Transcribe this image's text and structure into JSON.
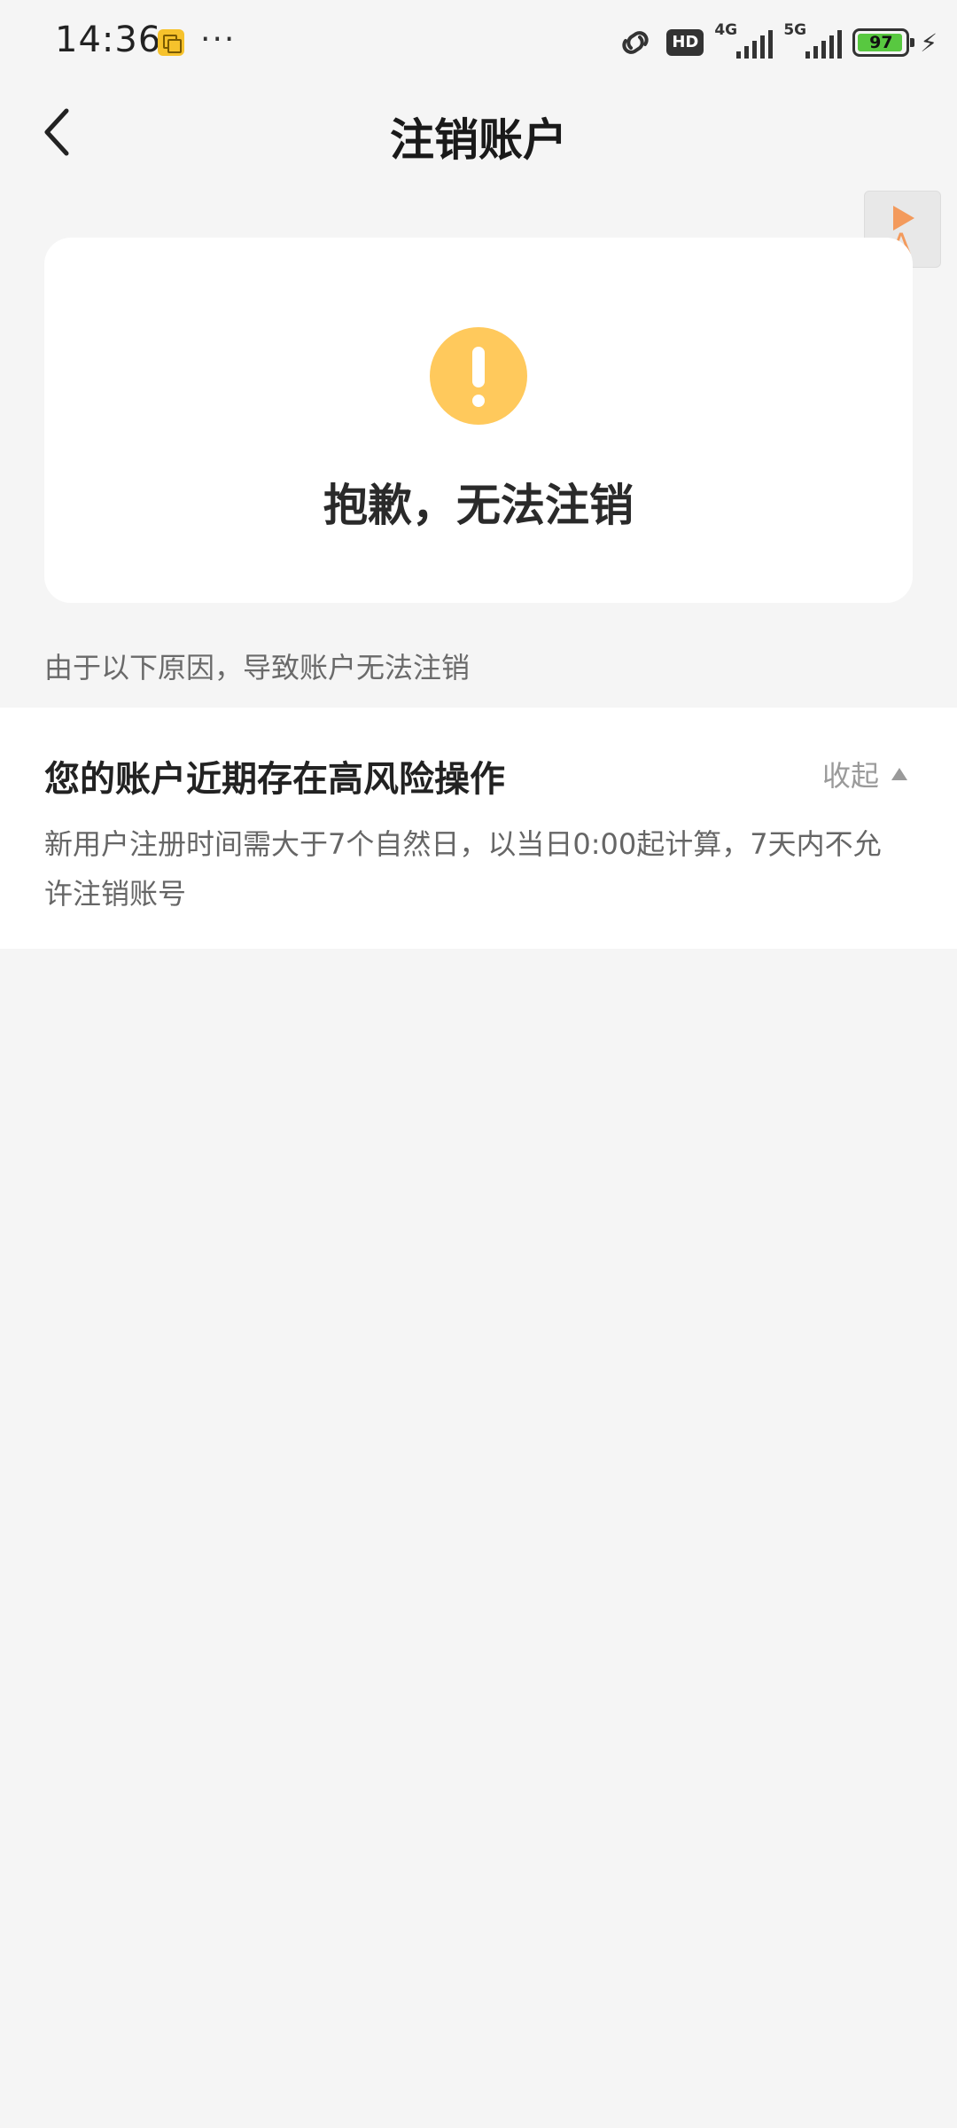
{
  "status_bar": {
    "time": "14:36",
    "more": "···",
    "hd": "HD",
    "net1": "4G",
    "net2": "5G",
    "battery": "97",
    "icons": [
      "notification-icon",
      "link-icon",
      "hd-icon",
      "signal-icon",
      "battery-icon",
      "charging-icon"
    ]
  },
  "header": {
    "back_icon": "chevron-left-icon",
    "title": "注销账户"
  },
  "float_button": {
    "letter": "A",
    "icon": "translate-icon"
  },
  "result": {
    "icon": "warning-icon",
    "message": "抱歉，无法注销"
  },
  "reasons": {
    "caption": "由于以下原因，导致账户无法注销",
    "items": [
      {
        "title": "您的账户近期存在高风险操作",
        "toggle_label": "收起",
        "description": "新用户注册时间需大于7个自然日，以当日0:00起计算，7天内不允许注销账号"
      }
    ]
  },
  "colors": {
    "background": "#f5f5f5",
    "warning": "#ffc95c",
    "accent_orange": "#f39a5c",
    "battery_green": "#58c840"
  }
}
